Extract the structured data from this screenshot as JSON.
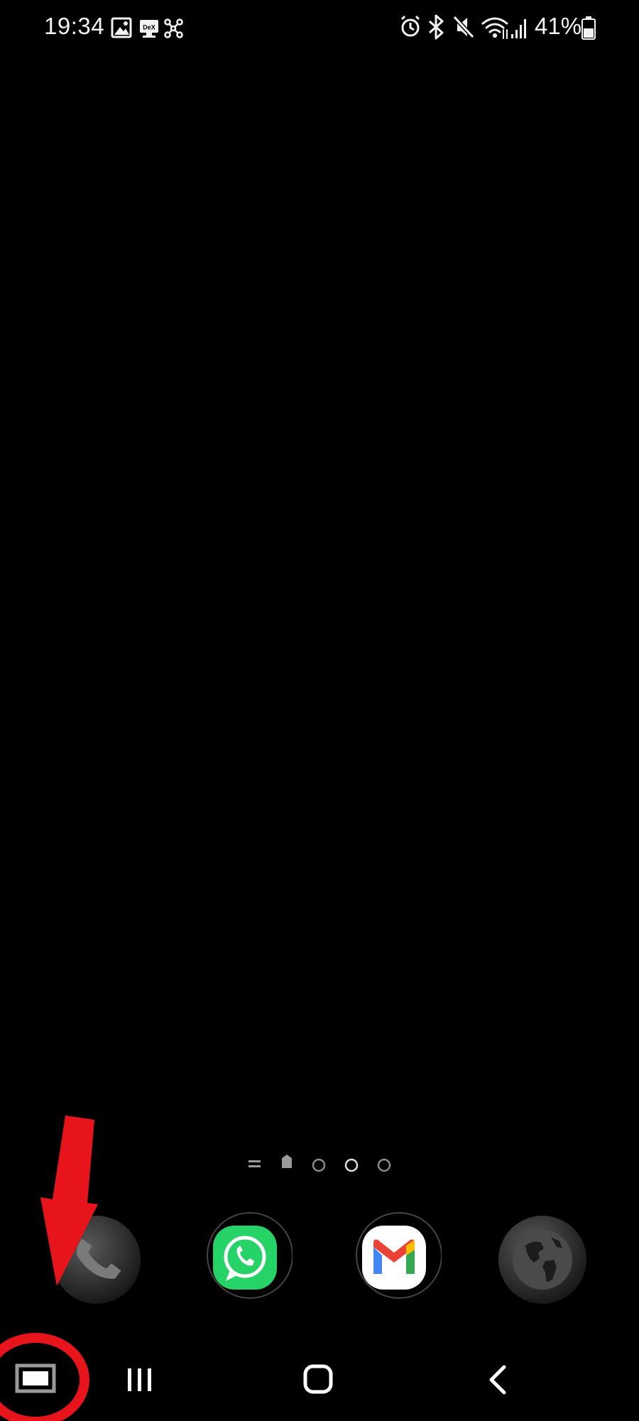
{
  "status_bar": {
    "time": "19:34",
    "battery_percent": "41%",
    "left_icons": [
      "gallery-icon",
      "dex-icon",
      "connection-icon"
    ],
    "right_icons": [
      "alarm-icon",
      "bluetooth-icon",
      "mute-icon",
      "wifi-icon",
      "signal-icon",
      "battery-icon"
    ],
    "dex_label": "DeX"
  },
  "page_indicator": {
    "pages": 3,
    "current_page": 2
  },
  "dock": {
    "apps": [
      {
        "icon": "phone-icon"
      },
      {
        "icon": "whatsapp-icon"
      },
      {
        "icon": "gmail-icon"
      },
      {
        "icon": "globe-icon"
      }
    ]
  },
  "nav_bar": {
    "buttons": [
      "screen-mode-button",
      "recent-apps-button",
      "home-button",
      "back-button"
    ]
  },
  "colors": {
    "background": "#000000",
    "annotation": "#e8141c",
    "whatsapp": "#25d366"
  }
}
